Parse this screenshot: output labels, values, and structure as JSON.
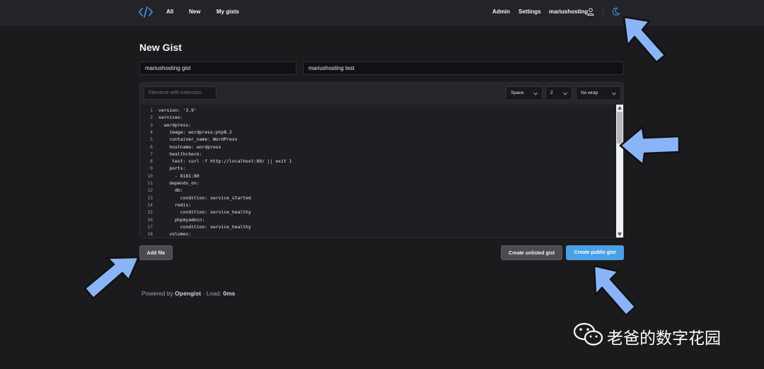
{
  "header": {
    "logo": "code-brackets-icon",
    "nav": [
      "All",
      "New",
      "My gists"
    ],
    "right": [
      "Admin",
      "Settings",
      "mariushosting"
    ],
    "user_icon": "user-icon",
    "theme_icon": "moon-icon"
  },
  "page_title": "New Gist",
  "fields": {
    "title_value": "mariushosting gist",
    "description_value": "mariushosting test",
    "filename_placeholder": "Filename with extension"
  },
  "editor": {
    "indent_type": "Space",
    "indent_size": "2",
    "wrap": "No wrap",
    "lines": [
      {
        "n": "1",
        "text": "version: '3.9'"
      },
      {
        "n": "2",
        "text": "services:"
      },
      {
        "n": "3",
        "text": "  wordpress:"
      },
      {
        "n": "4",
        "text": "    image: wordpress:php8.2"
      },
      {
        "n": "5",
        "text": "    container_name: WordPress"
      },
      {
        "n": "6",
        "text": "    hostname: wordpress"
      },
      {
        "n": "7",
        "text": "    healthcheck:"
      },
      {
        "n": "8",
        "text": "     test: curl -f http://localhost:80/ || exit 1"
      },
      {
        "n": "9",
        "text": "    ports:"
      },
      {
        "n": "10",
        "text": "      - 8181:80"
      },
      {
        "n": "11",
        "text": "    depends_on:"
      },
      {
        "n": "12",
        "text": "      db:"
      },
      {
        "n": "13",
        "text": "        condition: service_started"
      },
      {
        "n": "14",
        "text": "      redis:"
      },
      {
        "n": "15",
        "text": "        condition: service_healthy"
      },
      {
        "n": "16",
        "text": "      phpmyadmin:"
      },
      {
        "n": "17",
        "text": "        condition: service_healthy"
      },
      {
        "n": "18",
        "text": "    volumes:"
      }
    ]
  },
  "buttons": {
    "add_file": "Add file",
    "create_unlisted": "Create unlisted gist",
    "create_public": "Create public gist"
  },
  "footer": {
    "powered_by": "Powered by",
    "brand": "Opengist",
    "load_label": "Load:",
    "load_value": "0ms"
  },
  "watermark": {
    "text": "老爸的数字花园",
    "icon": "wechat-icon"
  },
  "colors": {
    "accent": "#3b8fdb",
    "primary_button": "#4aa0e6",
    "secondary_button": "#4b4c52",
    "annotation_arrow": "#8ab4f8"
  }
}
